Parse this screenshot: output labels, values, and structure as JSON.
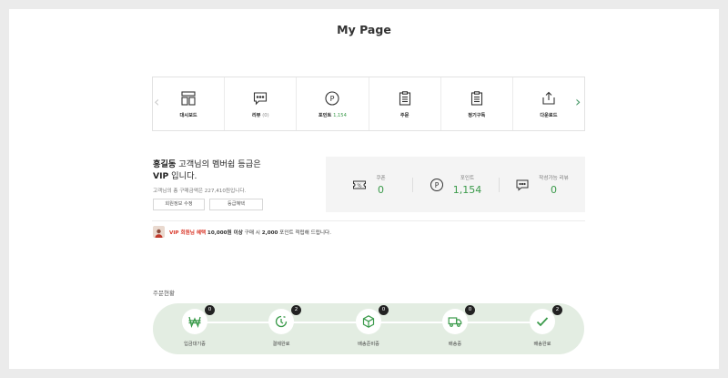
{
  "page_title": "My Page",
  "menu": {
    "prev_arrow": "‹",
    "next_arrow": "›",
    "items": [
      {
        "label": "대시보드",
        "extra": ""
      },
      {
        "label": "리뷰",
        "extra": "(0)"
      },
      {
        "label": "포인트",
        "extra": "1,154"
      },
      {
        "label": "주문",
        "extra": ""
      },
      {
        "label": "정기구독",
        "extra": ""
      },
      {
        "label": "다운로드",
        "extra": ""
      }
    ]
  },
  "membership": {
    "name": "홍길동",
    "line1_rest": " 고객님의 멤버쉽 등급은",
    "grade": "VIP",
    "line2_rest": " 입니다.",
    "total_purchase": "고객님의 총 구매금액은 227,410원입니다.",
    "edit_button": "회원정보 수정",
    "benefit_button": "등급혜택"
  },
  "stats": [
    {
      "label": "쿠폰",
      "value": "0",
      "icon": "coupon-icon"
    },
    {
      "label": "포인트",
      "value": "1,154",
      "icon": "point-icon"
    },
    {
      "label": "작성가능 리뷰",
      "value": "0",
      "icon": "review-icon"
    }
  ],
  "notice": {
    "highlight": "VIP 회원님 혜택",
    "bold_amount": "10,000원 이상",
    "mid": " 구매 시 ",
    "bold_points": "2,000",
    "end": " 포인트 적립해 드립니다."
  },
  "order_status": {
    "title": "주문현황",
    "steps": [
      {
        "label": "입금대기중",
        "count": "0",
        "icon": "won-icon"
      },
      {
        "label": "결제완료",
        "count": "2",
        "icon": "clock-icon"
      },
      {
        "label": "배송준비중",
        "count": "0",
        "icon": "box-icon"
      },
      {
        "label": "배송중",
        "count": "0",
        "icon": "truck-icon"
      },
      {
        "label": "배송완료",
        "count": "2",
        "icon": "check-icon"
      }
    ]
  },
  "colors": {
    "accent": "#3a9a4a",
    "track_bg": "#e3ede2",
    "highlight_red": "#d9382a"
  }
}
